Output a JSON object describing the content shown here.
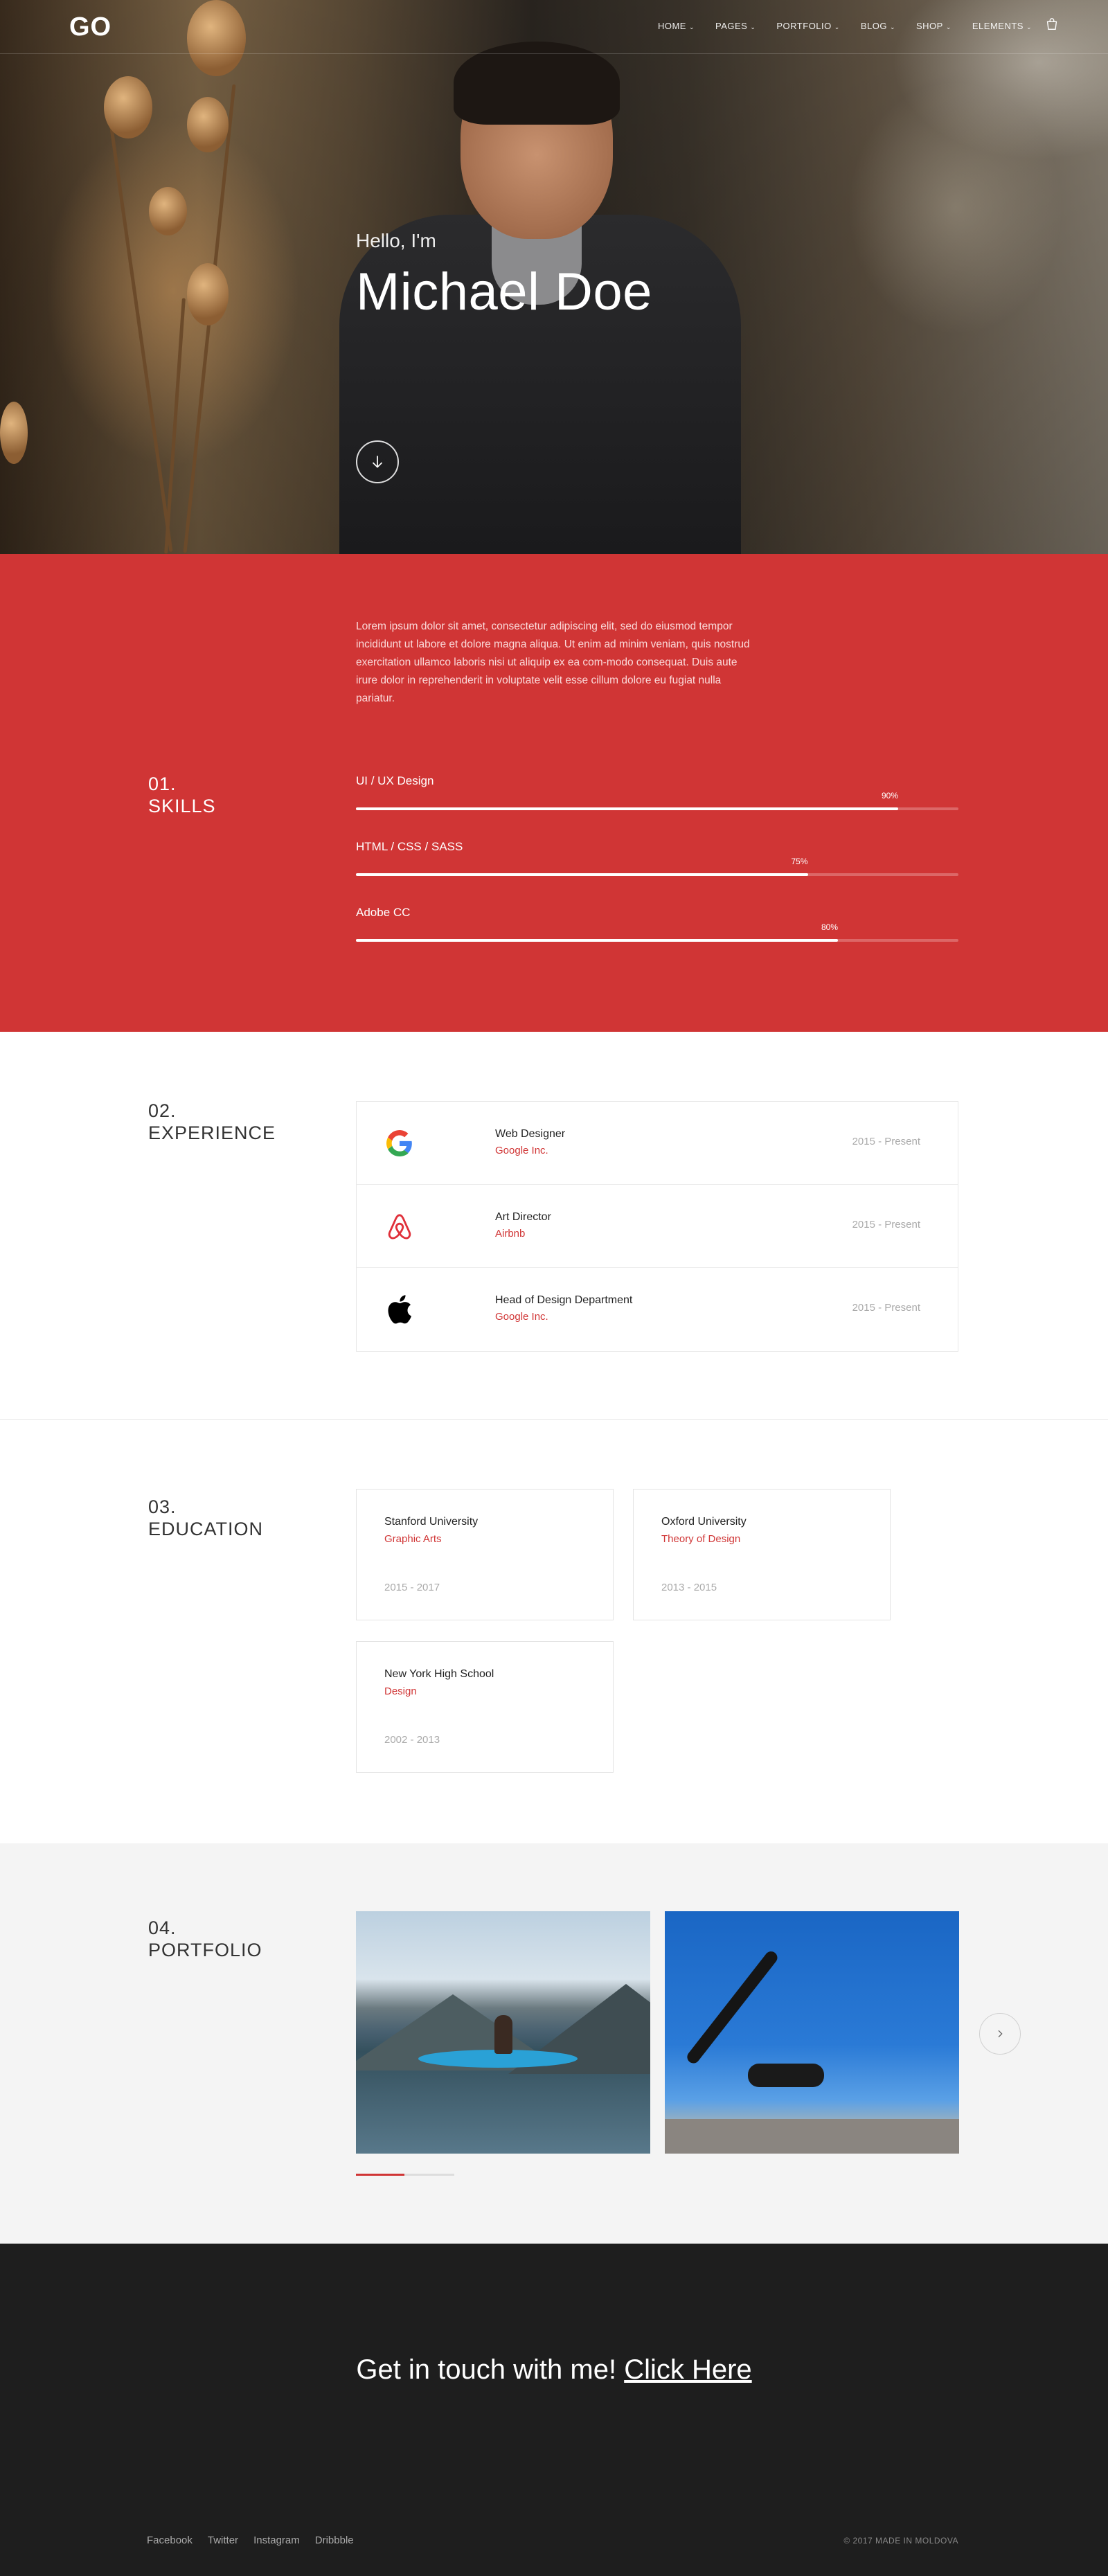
{
  "header": {
    "logo": "GO",
    "nav": [
      {
        "label": "HOME"
      },
      {
        "label": "PAGES"
      },
      {
        "label": "PORTFOLIO"
      },
      {
        "label": "BLOG"
      },
      {
        "label": "SHOP"
      },
      {
        "label": "ELEMENTS"
      }
    ],
    "cart_icon": "shopping-bag-icon"
  },
  "hero": {
    "greeting": "Hello, I'm",
    "name": "Michael Doe",
    "scroll_icon": "arrow-down-icon"
  },
  "skills": {
    "intro": "Lorem ipsum dolor sit amet, consectetur adipiscing elit, sed do eiusmod tempor incididunt ut labore et dolore magna aliqua. Ut enim ad minim veniam, quis nostrud exercitation ullamco laboris nisi ut aliquip ex ea com-modo consequat. Duis aute irure dolor in reprehenderit in voluptate velit esse cillum dolore eu fugiat nulla pariatur.",
    "number": "01.",
    "title": "SKILLS",
    "items": [
      {
        "label": "UI / UX Design",
        "percent_text": "90%",
        "percent": 90
      },
      {
        "label": "HTML / CSS / SASS",
        "percent_text": "75%",
        "percent": 75
      },
      {
        "label": "Adobe CC",
        "percent_text": "80%",
        "percent": 80
      }
    ],
    "accent_color": "#d03535"
  },
  "experience": {
    "number": "02.",
    "title": "EXPERIENCE",
    "items": [
      {
        "icon": "google-icon",
        "title": "Web Designer",
        "company": "Google Inc.",
        "dates": "2015 - Present"
      },
      {
        "icon": "airbnb-icon",
        "title": "Art Director",
        "company": "Airbnb",
        "dates": "2015 - Present"
      },
      {
        "icon": "apple-icon",
        "title": "Head of Design Department",
        "company": "Google Inc.",
        "dates": "2015 - Present"
      }
    ]
  },
  "education": {
    "number": "03.",
    "title": "EDUCATION",
    "items": [
      {
        "school": "Stanford University",
        "field": "Graphic Arts",
        "years": "2015 - 2017"
      },
      {
        "school": "Oxford University",
        "field": "Theory of Design",
        "years": "2013 - 2015"
      },
      {
        "school": "New York High School",
        "field": "Design",
        "years": "2002 - 2013"
      }
    ]
  },
  "portfolio": {
    "number": "04.",
    "title": "PORTFOLIO",
    "next_icon": "chevron-right-icon"
  },
  "footer": {
    "cta_text": "Get in touch with me!",
    "cta_link": "Click Here",
    "socials": [
      "Facebook",
      "Twitter",
      "Instagram",
      "Dribbble"
    ],
    "copyright": "© 2017 MADE  IN MOLDOVA"
  }
}
